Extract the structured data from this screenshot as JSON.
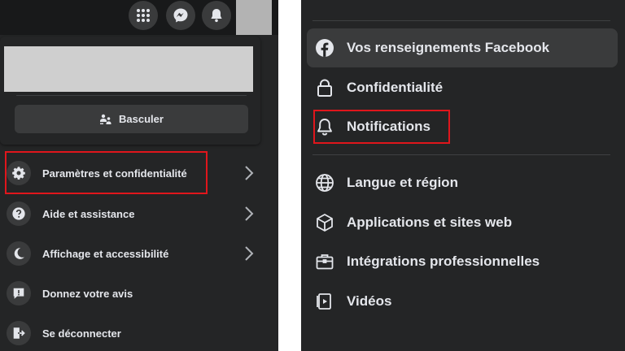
{
  "left_panel": {
    "top_icons": [
      {
        "name": "menu-grid-icon"
      },
      {
        "name": "messenger-icon"
      },
      {
        "name": "bell-icon"
      }
    ],
    "switch_button": {
      "label": "Basculer",
      "icon": "switch-profile-icon"
    },
    "menu": [
      {
        "label": "Paramètres et confidentialité",
        "icon": "gear-icon",
        "has_chevron": true,
        "highlighted": true
      },
      {
        "label": "Aide et assistance",
        "icon": "question-icon",
        "has_chevron": true
      },
      {
        "label": "Affichage et accessibilité",
        "icon": "moon-icon",
        "has_chevron": true
      },
      {
        "label": "Donnez votre avis",
        "icon": "feedback-icon",
        "has_chevron": false
      },
      {
        "label": "Se déconnecter",
        "icon": "logout-icon",
        "has_chevron": false
      }
    ]
  },
  "right_panel": {
    "items": [
      {
        "label": "Vos renseignements Facebook",
        "icon": "facebook-logo-icon",
        "active": true
      },
      {
        "label": "Confidentialité",
        "icon": "lock-icon"
      },
      {
        "label": "Notifications",
        "icon": "bell-outline-icon",
        "highlighted": true
      },
      {
        "label": "Langue et région",
        "icon": "globe-icon"
      },
      {
        "label": "Applications et sites web",
        "icon": "cube-icon"
      },
      {
        "label": "Intégrations professionnelles",
        "icon": "briefcase-icon"
      },
      {
        "label": "Vidéos",
        "icon": "video-icon"
      }
    ]
  },
  "colors": {
    "panel_bg": "#242526",
    "row_bg": "#3a3b3c",
    "text": "#e4e6eb",
    "highlight": "#e0161c"
  }
}
